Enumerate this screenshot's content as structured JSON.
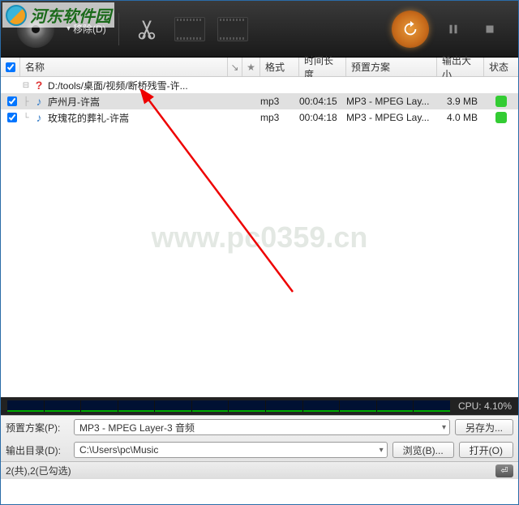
{
  "site": {
    "name": "河东软件园",
    "url_hint": "pc0359"
  },
  "toolbar": {
    "remove_label": "移除(D)"
  },
  "headers": {
    "name": "名称",
    "format": "格式",
    "duration": "时间长度",
    "preset": "预置方案",
    "outsize": "输出大小",
    "status": "状态"
  },
  "folder": {
    "path": "D:/tools/桌面/视频/断桥残雪-许..."
  },
  "files": [
    {
      "checked": true,
      "name": "庐州月-许嵩",
      "fmt": "mp3",
      "time": "00:04:15",
      "preset": "MP3 - MPEG Lay...",
      "size": "3.9 MB"
    },
    {
      "checked": true,
      "name": "玫瑰花的葬礼-许嵩",
      "fmt": "mp3",
      "time": "00:04:18",
      "preset": "MP3 - MPEG Lay...",
      "size": "4.0 MB"
    }
  ],
  "watermark": "www.pc0359.cn",
  "cpu": {
    "label": "CPU:",
    "value": "4.10%"
  },
  "bottom": {
    "preset_label": "预置方案(P):",
    "preset_value": "MP3 - MPEG Layer-3 音频",
    "saveas": "另存为...",
    "outdir_label": "输出目录(D):",
    "outdir_value": "C:\\Users\\pc\\Music",
    "browse": "浏览(B)...",
    "open": "打开(O)"
  },
  "status": {
    "text": "2(共),2(已勾选)",
    "return_glyph": "⏎"
  }
}
